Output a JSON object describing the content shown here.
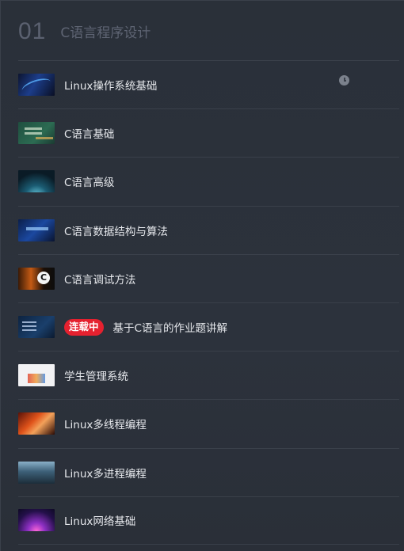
{
  "chapter": {
    "number": "01",
    "title": "C语言程序设计"
  },
  "lessons": [
    {
      "label": "Linux操作系统基础",
      "thumb": "t-linux",
      "badge": "",
      "has_clock": true
    },
    {
      "label": "C语言基础",
      "thumb": "t-cbasic",
      "badge": "",
      "has_clock": false
    },
    {
      "label": "C语言高级",
      "thumb": "t-cadv",
      "badge": "",
      "has_clock": false
    },
    {
      "label": "C语言数据结构与算法",
      "thumb": "t-cds",
      "badge": "",
      "has_clock": false
    },
    {
      "label": "C语言调试方法",
      "thumb": "t-cdebug",
      "badge": "",
      "has_clock": false
    },
    {
      "label": "基于C语言的作业题讲解",
      "thumb": "t-hw",
      "badge": "连载中",
      "has_clock": false
    },
    {
      "label": "学生管理系统",
      "thumb": "t-student",
      "badge": "",
      "has_clock": false
    },
    {
      "label": "Linux多线程编程",
      "thumb": "t-lthread",
      "badge": "",
      "has_clock": false
    },
    {
      "label": "Linux多进程编程",
      "thumb": "t-lproc",
      "badge": "",
      "has_clock": false
    },
    {
      "label": "Linux网络基础",
      "thumb": "t-lnet",
      "badge": "",
      "has_clock": false
    }
  ],
  "icons": {
    "clock": "clock-icon"
  },
  "colors": {
    "background": "#2b313b",
    "badge": "#e5212f",
    "divider": "#3a404a",
    "text": "#e6e8ec",
    "muted": "#5b6170"
  }
}
